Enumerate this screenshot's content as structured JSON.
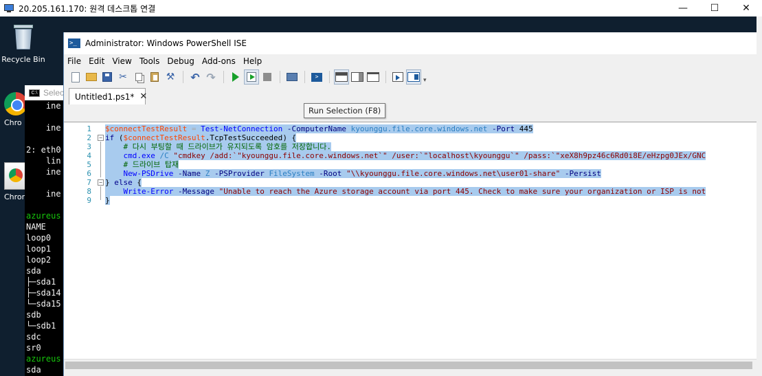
{
  "rdp": {
    "title": "20.205.161.170: 원격 데스크톱 연결",
    "controls": {
      "minimize": "—",
      "maximize": "☐",
      "close": "✕"
    }
  },
  "desktop": {
    "icons": [
      {
        "label": "Recycle Bin"
      },
      {
        "label": "Chro"
      },
      {
        "label": "Chrom"
      }
    ]
  },
  "console": {
    "title": "Selec",
    "icon_text": "C:\\",
    "lines": [
      "    ine",
      "",
      "    ine",
      "",
      "2: eth0",
      "    lin",
      "    ine",
      "",
      "    ine",
      "",
      "azureus",
      "NAME",
      "loop0",
      "loop1",
      "loop2",
      "sda",
      "├─sda1",
      "├─sda14",
      "└─sda15",
      "sdb",
      "└─sdb1",
      "sdc",
      "sr0",
      "azureus",
      "sda"
    ]
  },
  "ise": {
    "title": "Administrator: Windows PowerShell ISE",
    "icon_text": ">_",
    "menu": [
      "File",
      "Edit",
      "View",
      "Tools",
      "Debug",
      "Add-ons",
      "Help"
    ],
    "tooltip": "Run Selection (F8)",
    "tab": {
      "label": "Untitled1.ps1*",
      "close": "✕"
    },
    "line_numbers": [
      "1",
      "2",
      "3",
      "4",
      "5",
      "6",
      "7",
      "8",
      "9"
    ],
    "code": {
      "l1": [
        "$connectTestResult",
        " = ",
        "Test-NetConnection",
        " -ComputerName ",
        "kyounggu.file.core.windows.net",
        " -Port ",
        "445"
      ],
      "l2": [
        "if",
        " (",
        "$connectTestResult",
        ".TcpTestSucceeded",
        ") {"
      ],
      "l3": [
        "    ",
        "# 다시 부팅할 때 드라이브가 유지되도록 암호를 저장합니다."
      ],
      "l4": [
        "    ",
        "cmd.exe",
        " ",
        "/C",
        " ",
        "\"cmdkey /add:`\"kyounggu.file.core.windows.net`\" /user:`\"localhost\\kyounggu`\" /pass:`\"xeX8h9pz46c6Rd0i8E/eHzpg0JEx/GNC"
      ],
      "l5": [
        "    ",
        "# 드라이브 탑재"
      ],
      "l6": [
        "    ",
        "New-PSDrive",
        " -Name ",
        "Z",
        " -PSProvider ",
        "FileSystem",
        " -Root ",
        "\"\\\\kyounggu.file.core.windows.net\\user01-share\"",
        " -Persist"
      ],
      "l7": [
        "} ",
        "else",
        " {"
      ],
      "l8": [
        "    ",
        "Write-Error",
        " -Message ",
        "\"Unable to reach the Azure storage account via port 445. Check to make sure your organization or ISP is not"
      ],
      "l9": [
        "}"
      ]
    }
  },
  "colors": {
    "selection": "#a8cbee",
    "variable": "#ff4500",
    "command": "#0000ff",
    "string": "#8b0000",
    "comment": "#006400",
    "desktop_bg": "#0f1f2f"
  }
}
